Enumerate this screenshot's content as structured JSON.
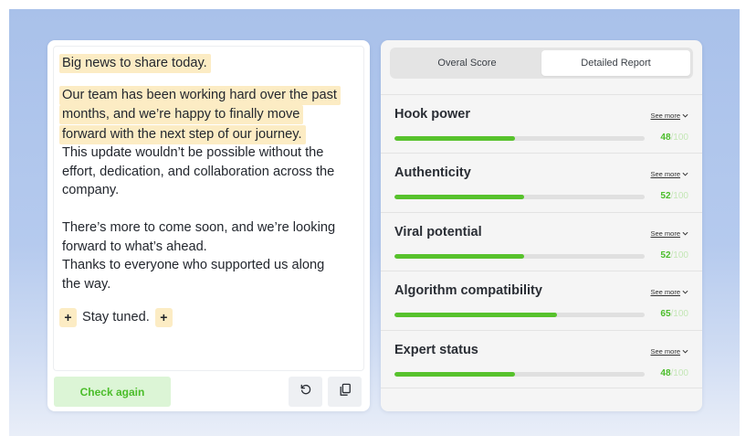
{
  "editor": {
    "line1": "Big news to share today.",
    "highlight_lines": [
      "Our team has been working hard over the past",
      "months, and we’re happy to finally move",
      "forward with the next step of our journey."
    ],
    "body_lines_a": [
      "This update wouldn’t be possible without the",
      "effort, dedication, and collaboration across the",
      "company."
    ],
    "body_lines_b": [
      "There’s more to come soon, and we’re looking",
      "forward to what’s ahead.",
      "Thanks to everyone who supported us along",
      "the way."
    ],
    "plus_symbol": "+",
    "closing": "Stay tuned.",
    "check_again_label": "Check again",
    "highlight_color": "#fcecc4"
  },
  "toolbar": {
    "reset_icon": "refresh-icon",
    "copy_icon": "copy-icon"
  },
  "report": {
    "tabs": [
      {
        "label": "Overal Score",
        "active": false
      },
      {
        "label": "Detailed Report",
        "active": true
      }
    ],
    "see_more_label": "See more",
    "accent_color": "#57c22c",
    "metrics": [
      {
        "name": "Hook power",
        "score": 48,
        "max": "/100"
      },
      {
        "name": "Authenticity",
        "score": 52,
        "max": "/100"
      },
      {
        "name": "Viral potential",
        "score": 52,
        "max": "/100"
      },
      {
        "name": "Algorithm compatibility",
        "score": 65,
        "max": "/100"
      },
      {
        "name": "Expert status",
        "score": 48,
        "max": "/100"
      }
    ]
  }
}
